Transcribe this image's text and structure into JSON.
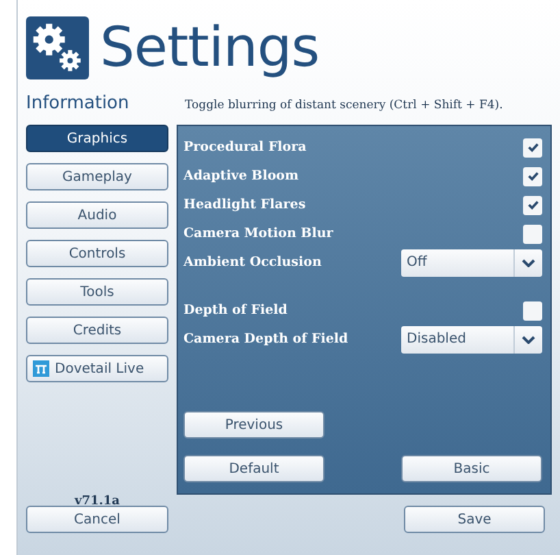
{
  "header": {
    "title": "Settings"
  },
  "info": {
    "label": "Information",
    "text": "Toggle blurring of distant scenery (Ctrl + Shift + F4)."
  },
  "sidebar": {
    "items": [
      {
        "label": "Graphics",
        "selected": true,
        "kind": "tab"
      },
      {
        "label": "Gameplay",
        "selected": false,
        "kind": "tab"
      },
      {
        "label": "Audio",
        "selected": false,
        "kind": "tab"
      },
      {
        "label": "Controls",
        "selected": false,
        "kind": "tab"
      },
      {
        "label": "Tools",
        "selected": false,
        "kind": "tab"
      },
      {
        "label": "Credits",
        "selected": false,
        "kind": "tab"
      },
      {
        "label": "Dovetail Live",
        "selected": false,
        "kind": "link"
      }
    ],
    "version": "v71.1a"
  },
  "setting_groups": [
    [
      {
        "label": "Procedural Flora",
        "kind": "checkbox",
        "checked": true
      },
      {
        "label": "Adaptive Bloom",
        "kind": "checkbox",
        "checked": true
      },
      {
        "label": "Headlight Flares",
        "kind": "checkbox",
        "checked": true
      },
      {
        "label": "Camera Motion Blur",
        "kind": "checkbox",
        "checked": false
      },
      {
        "label": "Ambient Occlusion",
        "kind": "dropdown",
        "value": "Off"
      }
    ],
    [
      {
        "label": "Depth of Field",
        "kind": "checkbox",
        "checked": false
      },
      {
        "label": "Camera Depth of Field",
        "kind": "dropdown",
        "value": "Disabled"
      }
    ]
  ],
  "panel_buttons": {
    "previous": "Previous",
    "default": "Default",
    "basic": "Basic"
  },
  "footer": {
    "cancel": "Cancel",
    "save": "Save"
  }
}
